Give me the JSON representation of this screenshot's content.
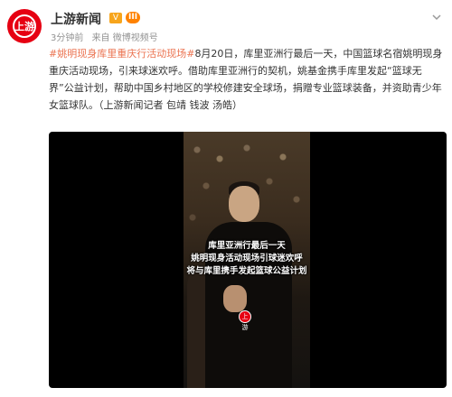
{
  "account": {
    "name": "上游新闻",
    "avatar_text": "上游",
    "verified_icon": "verified-v-icon",
    "level_badge": "III",
    "time": "3分钟前",
    "source": "来自 微博视频号"
  },
  "post": {
    "hashtag": "#姚明现身库里重庆行活动现场#",
    "body": "8月20日，库里亚洲行最后一天，中国篮球名宿姚明现身重庆活动现场，引来球迷欢呼。借助库里亚洲行的契机，姚基金携手库里发起“篮球无界”公益计划，帮助中国乡村地区的学校修建安全球场，捐赠专业篮球装备，并资助青少年女篮球队。（上游新闻记者 包靖 钱波 汤皓）"
  },
  "video": {
    "caption": [
      "库里亚洲行最后一天",
      "姚明现身活动现场引球迷欢呼",
      "将与库里携手发起篮球公益计划"
    ],
    "watermark": "上游"
  },
  "colors": {
    "hashtag": "#eb7350",
    "brand_red": "#e60012",
    "meta_gray": "#939393"
  }
}
